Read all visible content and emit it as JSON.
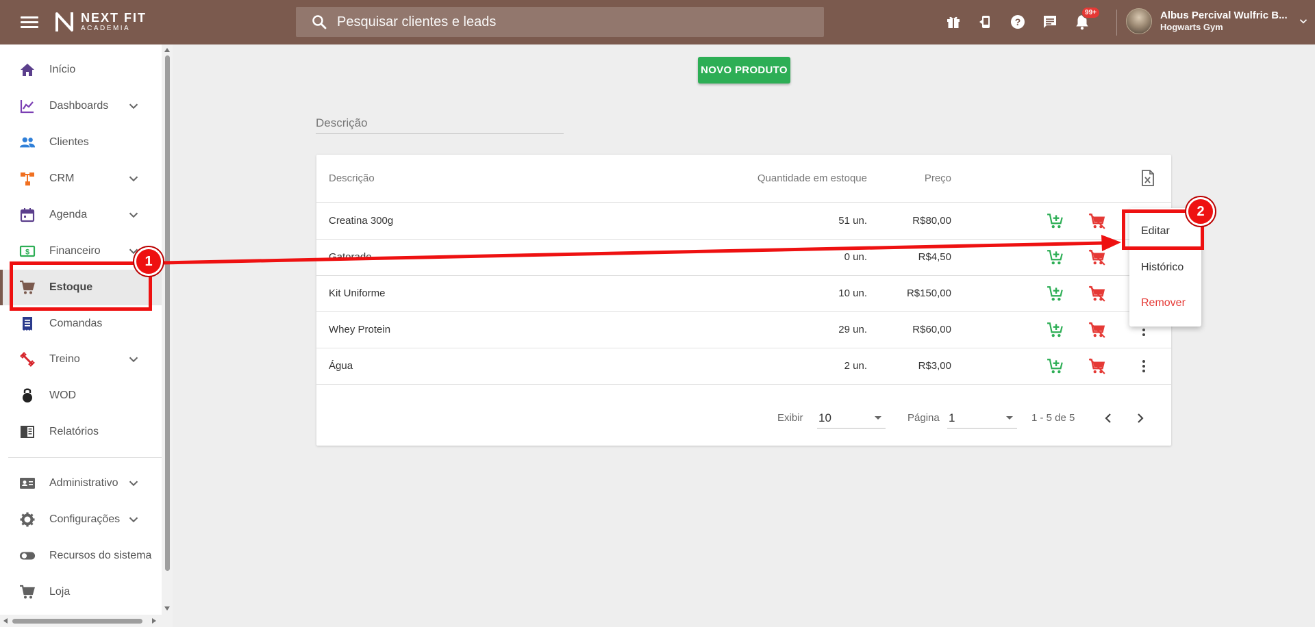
{
  "header": {
    "logo_main": "NEXT FIT",
    "logo_sub": "ACADEMIA",
    "search_placeholder": "Pesquisar clientes e leads",
    "notification_badge": "99+",
    "user_name": "Albus Percival Wulfric B...",
    "user_gym": "Hogwarts Gym",
    "icons": [
      "gift-icon",
      "mobile-device-icon",
      "help-icon",
      "chat-icon",
      "bell-icon"
    ]
  },
  "sidebar": {
    "items": [
      {
        "label": "Início",
        "icon": "home-icon",
        "color": "#5b3f8c",
        "expand": false
      },
      {
        "label": "Dashboards",
        "icon": "chart-line-icon",
        "color": "#7b3fb3",
        "expand": true
      },
      {
        "label": "Clientes",
        "icon": "people-icon",
        "color": "#2f7fd8",
        "expand": false
      },
      {
        "label": "CRM",
        "icon": "crm-hierarchy-icon",
        "color": "#f07021",
        "expand": true
      },
      {
        "label": "Agenda",
        "icon": "calendar-icon",
        "color": "#5b3f8c",
        "expand": true
      },
      {
        "label": "Financeiro",
        "icon": "money-icon",
        "color": "#2dae55",
        "expand": true
      },
      {
        "label": "Estoque",
        "icon": "shopping-cart-icon",
        "color": "#7b5a4e",
        "expand": false
      },
      {
        "label": "Comandas",
        "icon": "receipt-icon",
        "color": "#2a3a8c",
        "expand": false
      },
      {
        "label": "Treino",
        "icon": "dumbbell-icon",
        "color": "#d6262d",
        "expand": true
      },
      {
        "label": "WOD",
        "icon": "kettlebell-icon",
        "color": "#222222",
        "expand": false
      },
      {
        "label": "Relatórios",
        "icon": "report-icon",
        "color": "#444444",
        "expand": false
      },
      {
        "label": "Administrativo",
        "icon": "id-card-icon",
        "color": "#616161",
        "expand": true
      },
      {
        "label": "Configurações",
        "icon": "gear-icon",
        "color": "#616161",
        "expand": true
      },
      {
        "label": "Recursos do sistema",
        "icon": "toggle-icon",
        "color": "#616161",
        "expand": false
      },
      {
        "label": "Loja",
        "icon": "shopping-cart-icon",
        "color": "#616161",
        "expand": false
      }
    ],
    "active": "Estoque"
  },
  "main": {
    "new_button": "NOVO PRODUTO",
    "filter_placeholder": "Descrição",
    "table": {
      "headers": {
        "description": "Descrição",
        "quantity": "Quantidade em estoque",
        "price": "Preço"
      },
      "rows": [
        {
          "description": "Creatina 300g",
          "quantity": "51 un.",
          "price": "R$80,00"
        },
        {
          "description": "Gatorade",
          "quantity": "0 un.",
          "price": "R$4,50"
        },
        {
          "description": "Kit Uniforme",
          "quantity": "10 un.",
          "price": "R$150,00"
        },
        {
          "description": "Whey Protein",
          "quantity": "29 un.",
          "price": "R$60,00"
        },
        {
          "description": "Água",
          "quantity": "2 un.",
          "price": "R$3,00"
        }
      ]
    },
    "pagination": {
      "show_label": "Exibir",
      "show_value": "10",
      "page_label": "Página",
      "page_value": "1",
      "range": "1 - 5 de 5"
    }
  },
  "context_menu": {
    "items": [
      {
        "label": "Editar"
      },
      {
        "label": "Histórico"
      },
      {
        "label": "Remover"
      }
    ]
  },
  "annotations": {
    "step1": "1",
    "step2": "2"
  },
  "colors": {
    "topbar": "#7b5a4e",
    "accent_green": "#2dae55",
    "danger_red": "#e53935",
    "annotation_red": "#ee1111"
  }
}
